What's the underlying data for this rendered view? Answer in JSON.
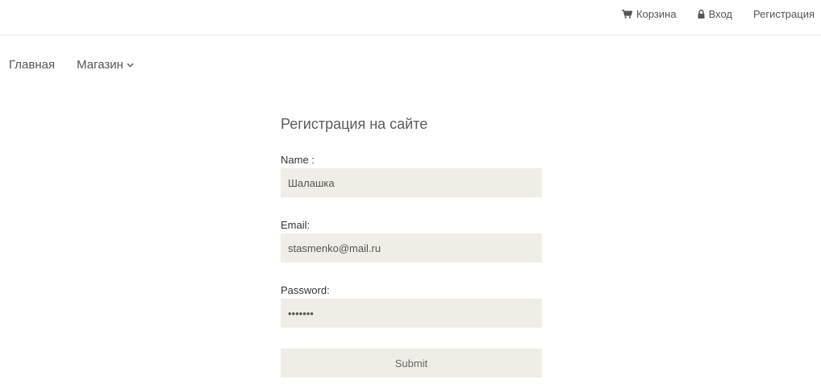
{
  "header": {
    "cart_label": "Корзина",
    "login_label": "Вход",
    "register_label": "Регистрация",
    "cart_icon": "cart-icon",
    "login_icon": "lock-icon"
  },
  "nav": {
    "home_label": "Главная",
    "shop_label": "Магазин",
    "shop_icon": "chevron-down-icon"
  },
  "form": {
    "title": "Регистрация на сайте",
    "name_label": "Name :",
    "name_value": "Шалашка",
    "email_label": "Email:",
    "email_value": "stasmenko@mail.ru",
    "password_label": "Password:",
    "password_value": "•••••••",
    "submit_label": "Submit"
  },
  "colors": {
    "input_background": "#efede6",
    "text": "#555555"
  }
}
